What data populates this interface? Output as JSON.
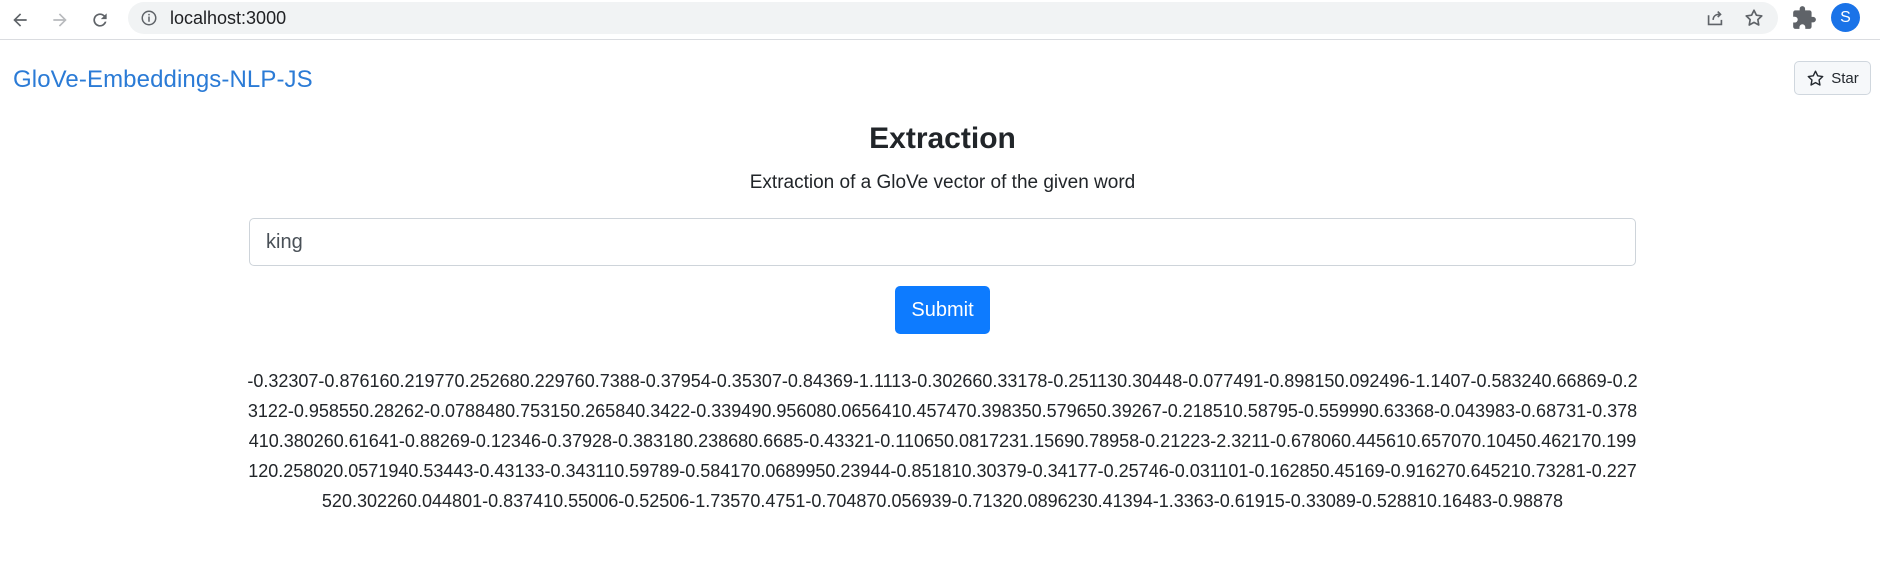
{
  "browser": {
    "url": "localhost:3000",
    "avatar_letter": "S",
    "accent": "#1a73e8"
  },
  "navbar": {
    "brand": "GloVe-Embeddings-NLP-JS",
    "star_label": "Star",
    "brand_color": "#2b7bd6"
  },
  "main": {
    "title": "Extraction",
    "subtitle": "Extraction of a GloVe vector of the given word",
    "input_value": "king",
    "submit_label": "Submit",
    "submit_color": "#0d7bff",
    "vector_output": "-0.32307-0.876160.219770.252680.229760.7388-0.37954-0.35307-0.84369-1.1113-0.302660.33178-0.251130.30448-0.077491-0.898150.092496-1.1407-0.583240.66869-0.23122-0.958550.28262-0.0788480.753150.265840.3422-0.339490.956080.0656410.457470.398350.579650.39267-0.218510.58795-0.559990.63368-0.043983-0.68731-0.378410.380260.61641-0.88269-0.12346-0.37928-0.383180.238680.6685-0.43321-0.110650.0817231.15690.78958-0.21223-2.3211-0.678060.445610.657070.10450.462170.199120.258020.0571940.53443-0.43133-0.343110.59789-0.584170.0689950.23944-0.851810.30379-0.34177-0.25746-0.031101-0.162850.45169-0.916270.645210.73281-0.227520.302260.044801-0.837410.55006-0.52506-1.73570.4751-0.704870.056939-0.71320.0896230.41394-1.3363-0.61915-0.33089-0.528810.16483-0.98878"
  },
  "icons": [
    "back-arrow-icon",
    "forward-arrow-icon",
    "reload-icon",
    "info-icon",
    "share-icon",
    "bookmark-star-icon",
    "puzzle-icon",
    "star-outline-icon"
  ]
}
